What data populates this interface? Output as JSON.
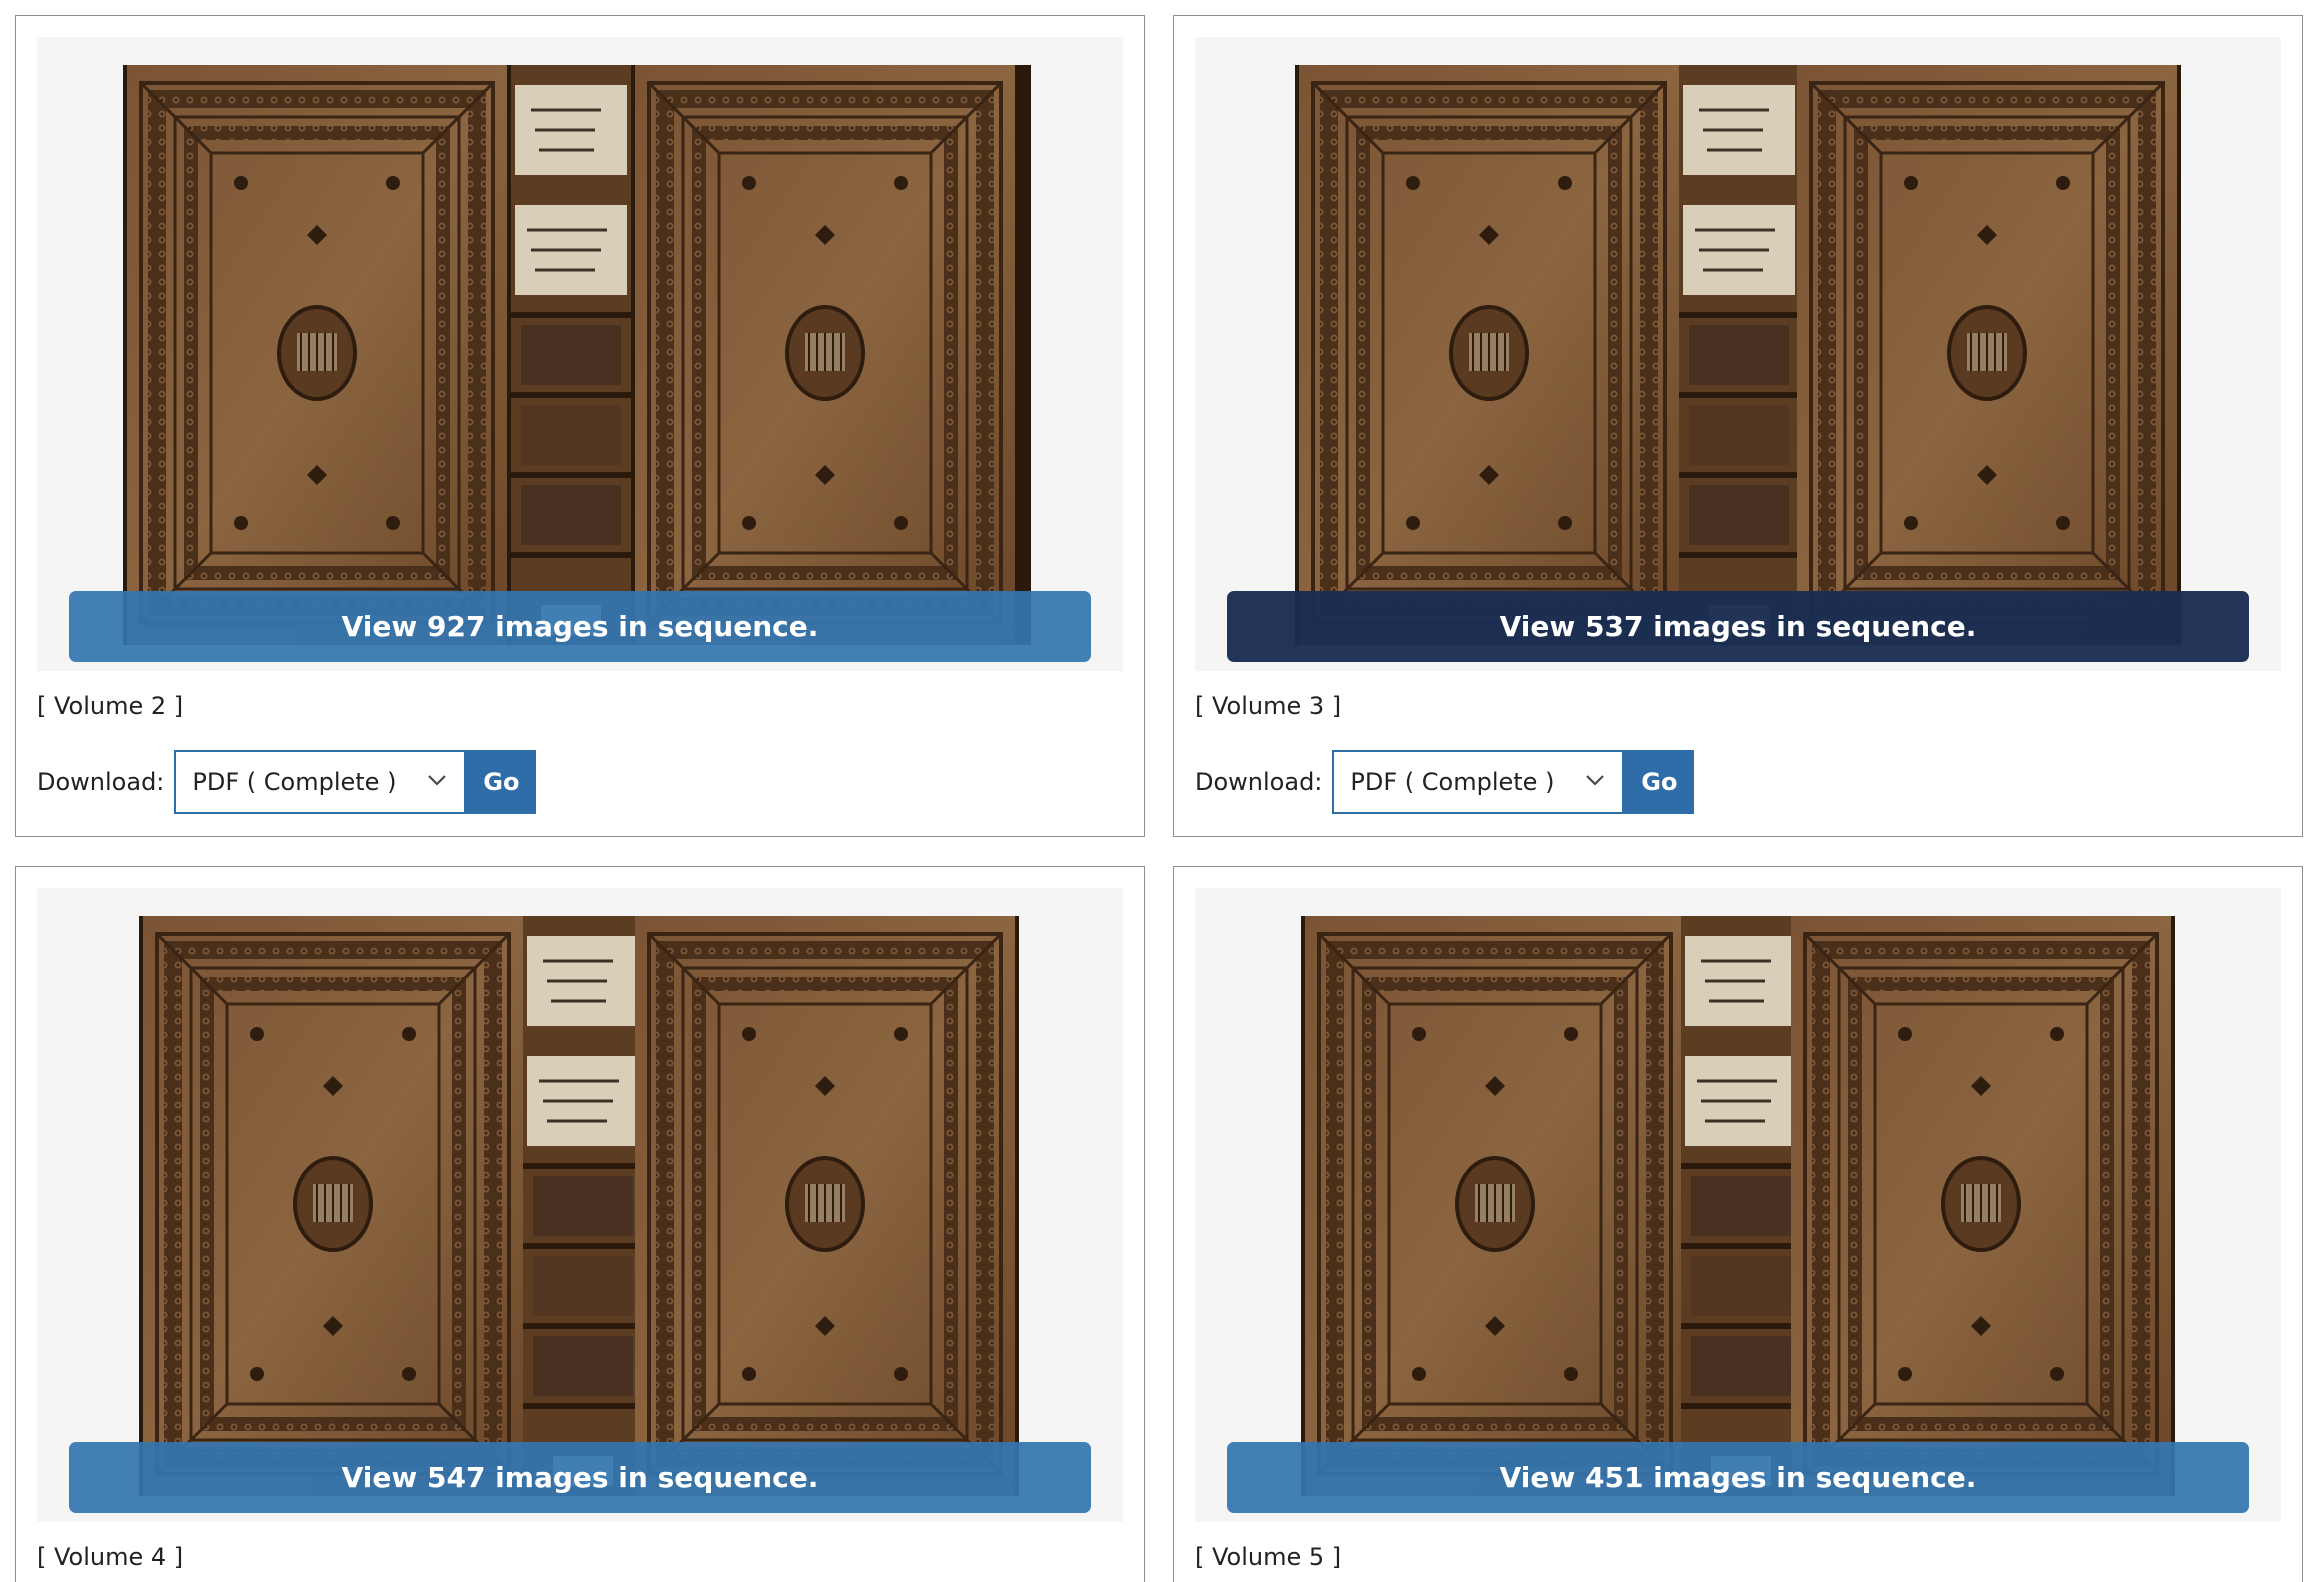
{
  "volumes": [
    {
      "view_label": "View 927 images in sequence.",
      "volume_label": "[ Volume 2 ]",
      "download_label": "Download:",
      "download_option": "PDF ( Complete )",
      "go_label": "Go",
      "cover_image": "book-cover-photo"
    },
    {
      "view_label": "View 537 images in sequence.",
      "volume_label": "[ Volume 3 ]",
      "download_label": "Download:",
      "download_option": "PDF ( Complete )",
      "go_label": "Go",
      "cover_image": "book-cover-photo",
      "state": "hovered"
    },
    {
      "view_label": "View 547 images in sequence.",
      "volume_label": "[ Volume 4 ]",
      "cover_image": "book-cover-photo"
    },
    {
      "view_label": "View 451 images in sequence.",
      "volume_label": "[ Volume 5 ]",
      "cover_image": "book-cover-photo"
    }
  ],
  "colors": {
    "button_blue": "#3475af",
    "button_hover": "#192d52",
    "select_border": "#2f6da8",
    "card_border": "#8f8f8f",
    "thumb_bg": "#f5f5f5"
  }
}
